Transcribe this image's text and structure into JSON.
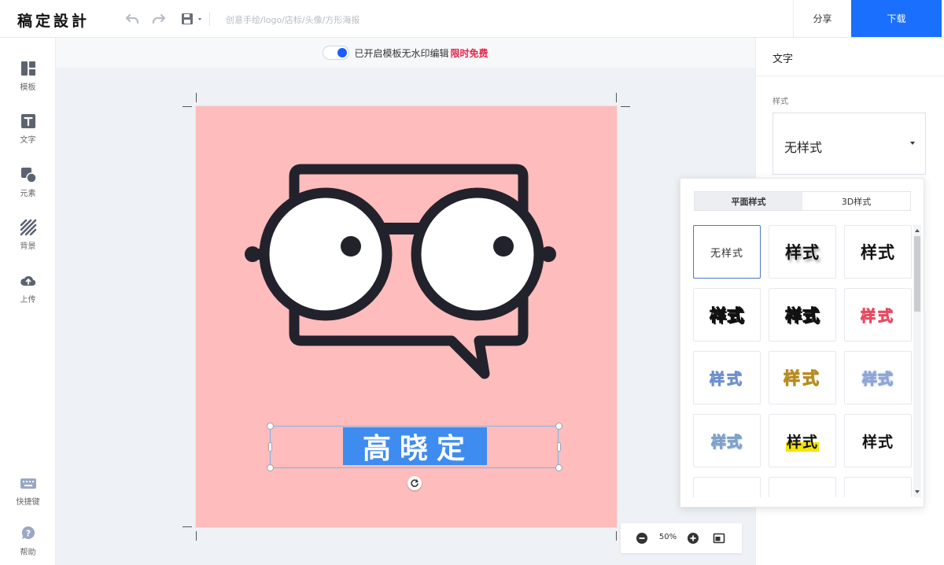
{
  "app": {
    "logo": "稿定設計",
    "title_placeholder": "创意手绘/logo/店标/头像/方形海报",
    "share_label": "分享",
    "download_label": "下载"
  },
  "sidebar": {
    "items": [
      {
        "label": "模板",
        "icon": "template-icon"
      },
      {
        "label": "文字",
        "icon": "text-icon"
      },
      {
        "label": "元素",
        "icon": "elements-icon"
      },
      {
        "label": "背景",
        "icon": "background-icon"
      },
      {
        "label": "上传",
        "icon": "upload-icon"
      }
    ],
    "bottom_items": [
      {
        "label": "快捷键",
        "icon": "keyboard-icon"
      },
      {
        "label": "帮助",
        "icon": "help-icon"
      }
    ]
  },
  "watermark": {
    "text": "已开启模板无水印编辑",
    "highlight": "限时免费",
    "toggle_on": true
  },
  "canvas": {
    "background_color": "#ffbcbc",
    "selected_text": "高晓定"
  },
  "zoom": {
    "value": "50%"
  },
  "panel": {
    "title": "文字",
    "style_label": "样式",
    "style_value": "无样式",
    "tabs": [
      {
        "label": "平面样式",
        "active": true
      },
      {
        "label": "3D样式",
        "active": false
      }
    ],
    "presets": [
      {
        "label": "无样式"
      },
      {
        "label": "样式"
      },
      {
        "label": "样式"
      },
      {
        "label": "样式"
      },
      {
        "label": "样式"
      },
      {
        "label": "样式"
      },
      {
        "label": "样式"
      },
      {
        "label": "样式"
      },
      {
        "label": "样式"
      },
      {
        "label": "样式"
      },
      {
        "label": "样式"
      },
      {
        "label": "样式"
      }
    ]
  },
  "colors": {
    "accent": "#1a6ffe",
    "highlight_red": "#e5264b",
    "selection_blue": "#3f8cf0"
  }
}
